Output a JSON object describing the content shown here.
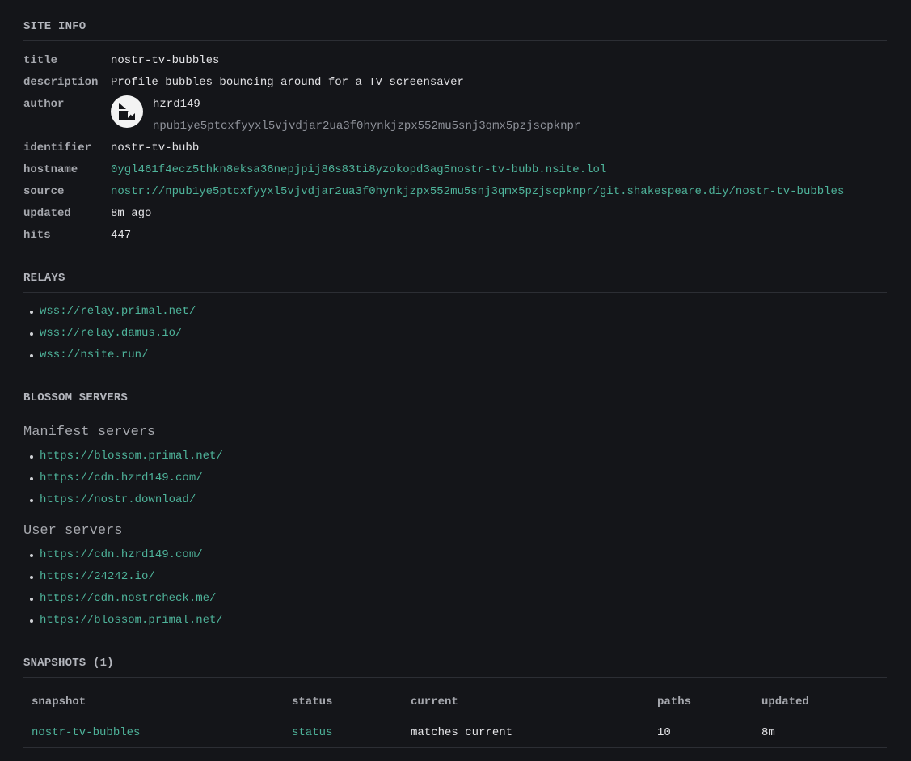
{
  "site_info": {
    "heading": "SITE INFO",
    "rows": {
      "title": {
        "key": "title",
        "value": "nostr-tv-bubbles"
      },
      "description": {
        "key": "description",
        "value": "Profile bubbles bouncing around for a TV screensaver"
      },
      "author": {
        "key": "author",
        "name": "hzrd149",
        "npub": "npub1ye5ptcxfyyxl5vjvdjar2ua3f0hynkjzpx552mu5snj3qmx5pzjscpknpr"
      },
      "identifier": {
        "key": "identifier",
        "value": "nostr-tv-bubb"
      },
      "hostname": {
        "key": "hostname",
        "value": "0ygl461f4ecz5thkn8eksa36nepjpij86s83ti8yzokopd3ag5nostr-tv-bubb.nsite.lol"
      },
      "source": {
        "key": "source",
        "value": "nostr://npub1ye5ptcxfyyxl5vjvdjar2ua3f0hynkjzpx552mu5snj3qmx5pzjscpknpr/git.shakespeare.diy/nostr-tv-bubbles"
      },
      "updated": {
        "key": "updated",
        "value": "8m ago"
      },
      "hits": {
        "key": "hits",
        "value": "447"
      }
    }
  },
  "relays": {
    "heading": "RELAYS",
    "items": [
      "wss://relay.primal.net/",
      "wss://relay.damus.io/",
      "wss://nsite.run/"
    ]
  },
  "blossom": {
    "heading": "BLOSSOM SERVERS",
    "manifest_heading": "Manifest servers",
    "manifest": [
      "https://blossom.primal.net/",
      "https://cdn.hzrd149.com/",
      "https://nostr.download/"
    ],
    "user_heading": "User servers",
    "user": [
      "https://cdn.hzrd149.com/",
      "https://24242.io/",
      "https://cdn.nostrcheck.me/",
      "https://blossom.primal.net/"
    ]
  },
  "snapshots": {
    "heading": "SNAPSHOTS (1)",
    "columns": [
      "snapshot",
      "status",
      "current",
      "paths",
      "updated"
    ],
    "rows": [
      {
        "snapshot": "nostr-tv-bubbles",
        "status": "status",
        "current": "matches current",
        "paths": "10",
        "updated": "8m"
      }
    ]
  },
  "colors": {
    "background": "#141519",
    "link": "#4eb39a",
    "text": "#e3e3e6",
    "muted": "#8f929a"
  }
}
